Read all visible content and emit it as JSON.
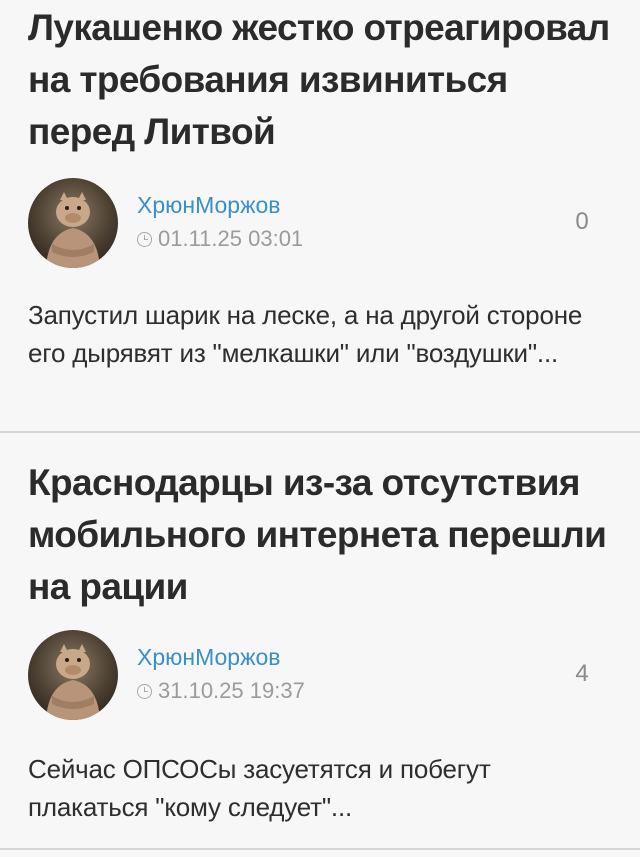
{
  "posts": [
    {
      "title": "Лукашенко жестко отреагировал на требования извиниться перед Литвой",
      "author": "ХрюнМоржов",
      "date": "01.11.25 03:01",
      "comments": "0",
      "excerpt": "Запустил шарик на леске, а на другой стороне его дырявят из \"мелкашки\" или \"воздушки\"..."
    },
    {
      "title": "Краснодарцы из-за отсутствия мобильного интернета перешли на рации",
      "author": "ХрюнМоржов",
      "date": "31.10.25 19:37",
      "comments": "4",
      "excerpt": "Сейчас ОПСОСы засуетятся и побегут плакаться \"кому следует\"..."
    }
  ],
  "colors": {
    "author_link": "#3a8fc9",
    "meta_text": "#9b9b9b",
    "divider": "#d6d6d6",
    "background": "#f7f7f7"
  },
  "icons": {
    "date": "clock-icon",
    "avatar": "user-avatar"
  }
}
